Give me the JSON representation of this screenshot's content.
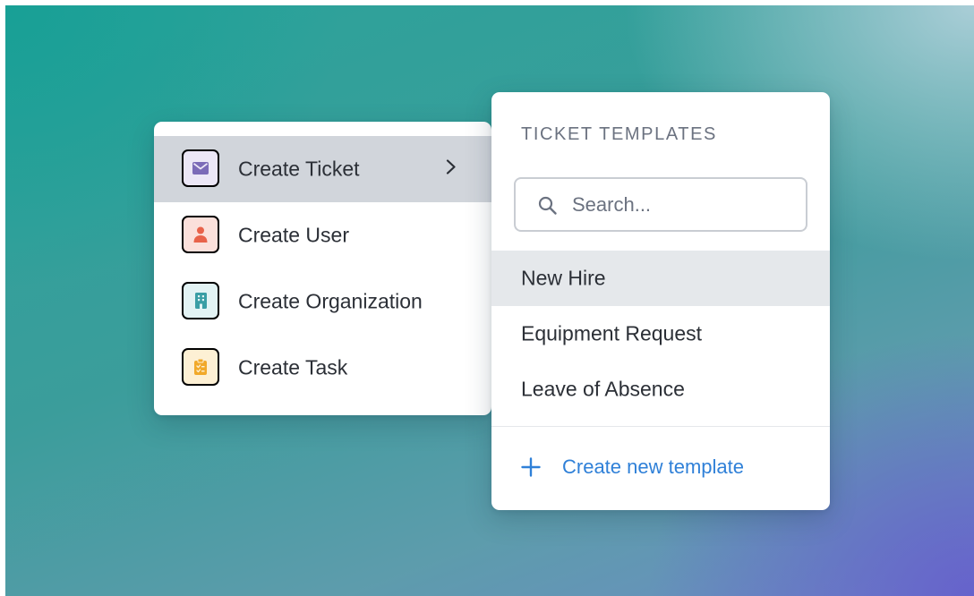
{
  "main_menu": {
    "items": [
      {
        "label": "Create Ticket",
        "icon": "envelope-icon",
        "color": "#7c6bb8",
        "active": true,
        "has_submenu": true
      },
      {
        "label": "Create User",
        "icon": "person-icon",
        "color": "#e8624a",
        "active": false
      },
      {
        "label": "Create Organization",
        "icon": "building-icon",
        "color": "#3a9ea5",
        "active": false
      },
      {
        "label": "Create Task",
        "icon": "clipboard-icon",
        "color": "#f1a92a",
        "active": false
      }
    ]
  },
  "submenu": {
    "title": "TICKET TEMPLATES",
    "search": {
      "placeholder": "Search...",
      "value": ""
    },
    "templates": [
      {
        "label": "New Hire",
        "active": true
      },
      {
        "label": "Equipment Request",
        "active": false
      },
      {
        "label": "Leave of Absence",
        "active": false
      }
    ],
    "create_label": "Create new template",
    "accent": "#2f80d8"
  }
}
